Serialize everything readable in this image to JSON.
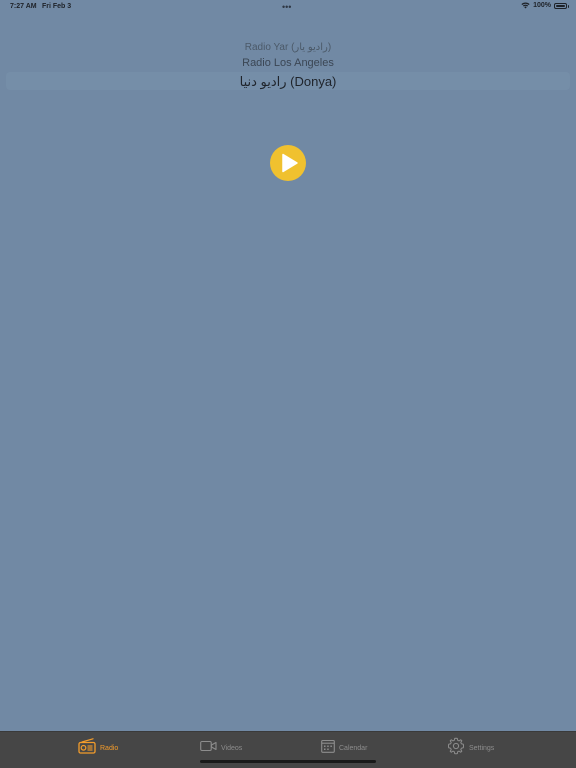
{
  "status_bar": {
    "time": "7:27 AM",
    "date": "Fri Feb 3",
    "multitask_dots": "•••",
    "battery_percent": "100%"
  },
  "station_picker": {
    "stations": [
      "Radio Yar (راديو يار)",
      "Radio Los Angeles",
      "راديو دنيا (Donya)"
    ],
    "selected_index": 2
  },
  "player": {
    "state": "paused",
    "accent_color": "#f0c12f"
  },
  "tab_bar": {
    "active_color": "#f39c2b",
    "inactive_color": "#8d8d8d",
    "tabs": [
      {
        "label": "Radio",
        "icon": "radio-icon",
        "active": true
      },
      {
        "label": "Videos",
        "icon": "video-camera-icon",
        "active": false
      },
      {
        "label": "Calendar",
        "icon": "calendar-icon",
        "active": false
      },
      {
        "label": "Settings",
        "icon": "gear-icon",
        "active": false
      }
    ]
  }
}
